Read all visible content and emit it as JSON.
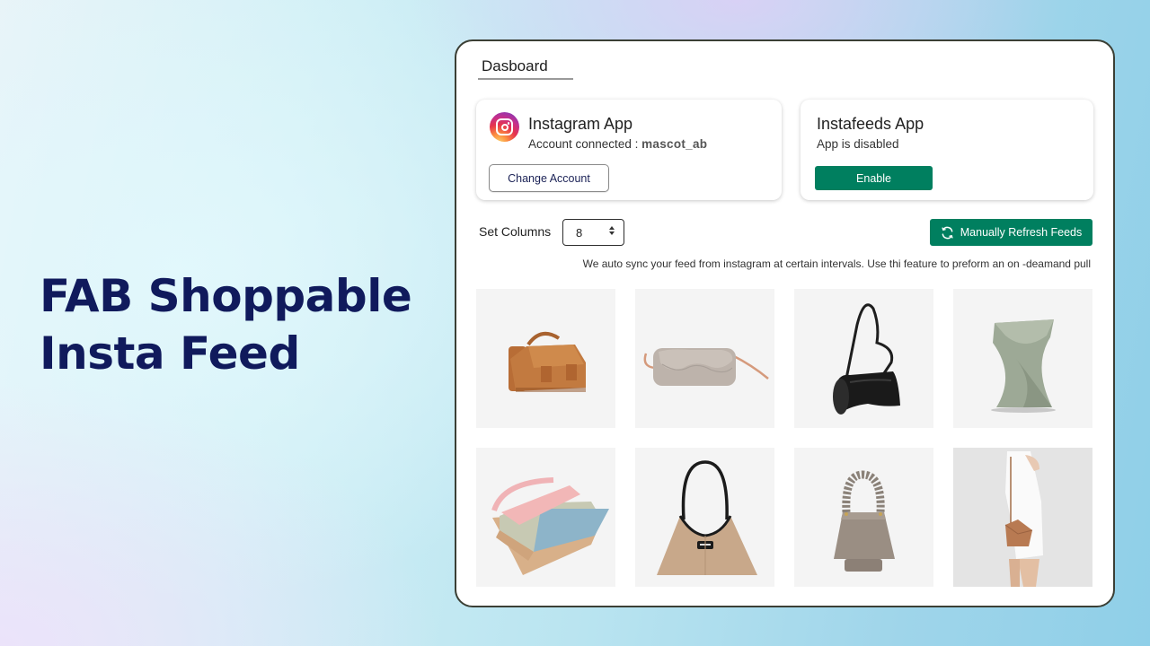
{
  "hero": {
    "line1": "FAB Shoppable",
    "line2": "Insta Feed"
  },
  "dashboard": {
    "tab_label": "Dasboard",
    "instagram_card": {
      "icon": "instagram-logo-icon",
      "title": "Instagram App",
      "account_prefix": "Account connected : ",
      "account_name": "mascot_ab",
      "button_label": "Change Account"
    },
    "instafeeds_card": {
      "title": "Instafeeds App",
      "status": "App is disabled",
      "button_label": "Enable"
    },
    "columns": {
      "label": "Set Columns",
      "value": "8"
    },
    "refresh": {
      "icon": "refresh-icon",
      "label": "Manually Refresh Feeds"
    },
    "sync_note": "We auto sync your feed from instagram at certain intervals. Use  thi feature to preform an on -deamand pull",
    "feed_items": [
      {
        "label": "Tan leather satchel bag"
      },
      {
        "label": "Taupe wavy-flap crossbody bag"
      },
      {
        "label": "Black curved shoulder bag"
      },
      {
        "label": "Sage twisted sculptural bag"
      },
      {
        "label": "Pastel color-block accordion bag"
      },
      {
        "label": "Beige hobo bag with black handle"
      },
      {
        "label": "Taupe bucket bag with braided handle"
      },
      {
        "label": "Model wearing tan origami crossbody bag"
      }
    ]
  },
  "colors": {
    "accent_green": "#007f5f",
    "hero_navy": "#101a5c",
    "button_text_navy": "#1b2256"
  }
}
